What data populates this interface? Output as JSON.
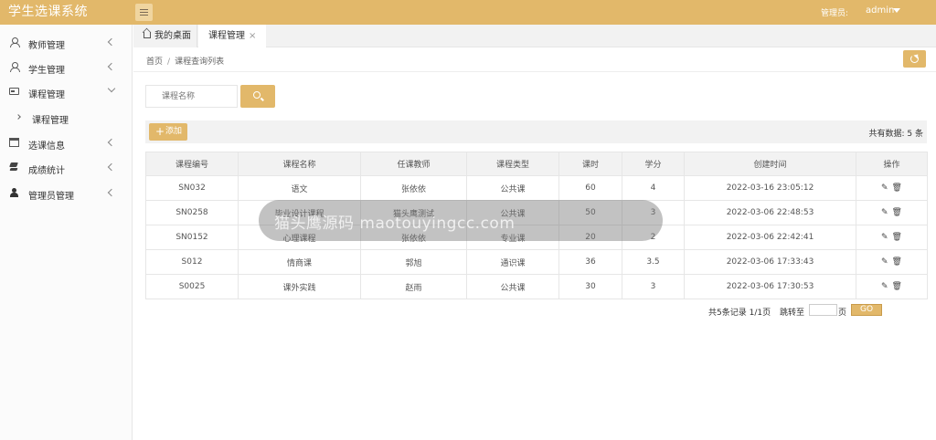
{
  "header": {
    "title": "学生选课系统",
    "admin_label": "管理员:",
    "admin_name": "admin"
  },
  "sidebar": {
    "items": [
      {
        "label": "教师管理",
        "icon": "user-icon"
      },
      {
        "label": "学生管理",
        "icon": "users-icon"
      },
      {
        "label": "课程管理",
        "icon": "card-icon",
        "expanded": true
      },
      {
        "label": "选课信息",
        "icon": "calendar-icon"
      },
      {
        "label": "成绩统计",
        "icon": "layers-icon"
      },
      {
        "label": "管理员管理",
        "icon": "admin-icon"
      }
    ],
    "subitem": {
      "label": "课程管理"
    }
  },
  "tabs": {
    "home": "我的桌面",
    "active": "课程管理",
    "close": "×"
  },
  "breadcrumb": {
    "home": "首页",
    "sep": "/",
    "current": "课程查询列表"
  },
  "search": {
    "placeholder": "课程名称"
  },
  "toolbar": {
    "add_label": "添加",
    "add_icon": "+",
    "total": "共有数据: 5 条"
  },
  "table": {
    "headers": [
      "课程编号",
      "课程名称",
      "任课教师",
      "课程类型",
      "课时",
      "学分",
      "创建时间",
      "操作"
    ],
    "rows": [
      [
        "SN032",
        "语文",
        "张依依",
        "公共课",
        "60",
        "4",
        "2022-03-16 23:05:12"
      ],
      [
        "SN0258",
        "毕业设计课程",
        "猫头鹰测试",
        "公共课",
        "50",
        "3",
        "2022-03-06 22:48:53"
      ],
      [
        "SN0152",
        "心理课程",
        "张依依",
        "专业课",
        "20",
        "2",
        "2022-03-06 22:42:41"
      ],
      [
        "S012",
        "情商课",
        "郭旭",
        "通识课",
        "36",
        "3.5",
        "2022-03-06 17:33:43"
      ],
      [
        "S0025",
        "课外实践",
        "赵雨",
        "公共课",
        "30",
        "3",
        "2022-03-06 17:30:53"
      ]
    ],
    "edit_icon": "✎",
    "delete_icon": "🗑"
  },
  "pagination": {
    "summary": "共5条记录  1/1页",
    "jump_label": "跳转至",
    "page_unit": "页",
    "go_label": "GO"
  },
  "overlay": {
    "text": "猫头鹰源码 maotouyingcc.com"
  },
  "colors": {
    "accent": "#e2b86a"
  }
}
